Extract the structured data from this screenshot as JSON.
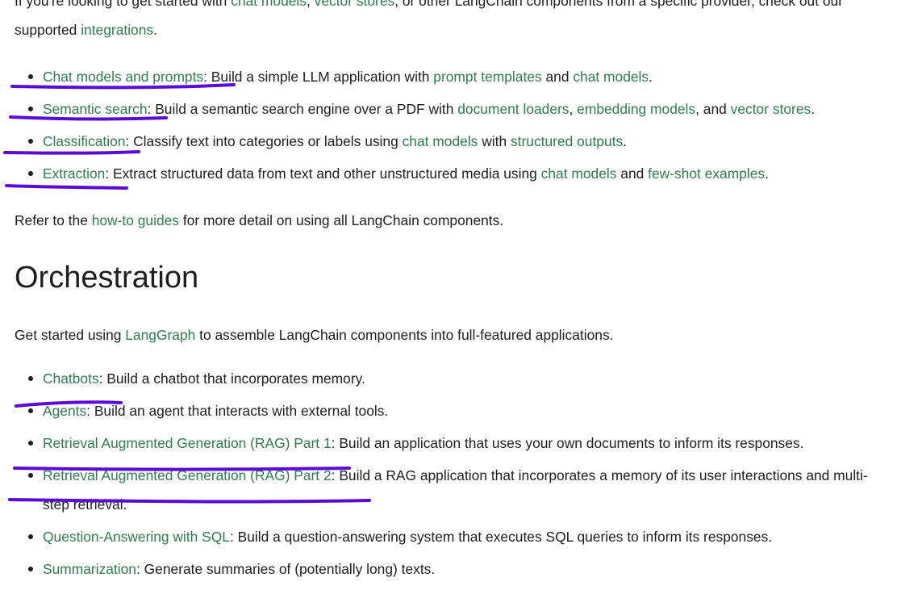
{
  "intro": {
    "t1": "If you're looking to get started with ",
    "l1": "chat models",
    "t2": ", ",
    "l2": "vector stores",
    "t3": ", or other LangChain components from a specific provider, check out our supported ",
    "l3": "integrations",
    "t4": "."
  },
  "basics": {
    "items": [
      {
        "link": "Chat models and prompts",
        "t1": ": Build a simple LLM application with ",
        "l1": "prompt templates",
        "t2": " and ",
        "l2": "chat models",
        "t3": "."
      },
      {
        "link": "Semantic search",
        "t1": ": Build a semantic search engine over a PDF with ",
        "l1": "document loaders",
        "t2": ", ",
        "l2": "embedding models",
        "t3": ", and ",
        "l3": "vector stores",
        "t4": "."
      },
      {
        "link": "Classification",
        "t1": ": Classify text into categories or labels using ",
        "l1": "chat models",
        "t2": " with ",
        "l2": "structured outputs",
        "t3": "."
      },
      {
        "link": "Extraction",
        "t1": ": Extract structured data from text and other unstructured media using ",
        "l1": "chat models",
        "t2": " and ",
        "l2": "few-shot examples",
        "t3": "."
      }
    ]
  },
  "refer": {
    "t1": "Refer to the ",
    "l1": "how-to guides",
    "t2": " for more detail on using all LangChain components."
  },
  "orchestration": {
    "heading": "Orchestration",
    "intro_t1": "Get started using ",
    "intro_l1": "LangGraph",
    "intro_t2": " to assemble LangChain components into full-featured applications.",
    "items": [
      {
        "link": "Chatbots",
        "text": ": Build a chatbot that incorporates memory."
      },
      {
        "link": "Agents",
        "text": ": Build an agent that interacts with external tools."
      },
      {
        "link": "Retrieval Augmented Generation (RAG) Part 1",
        "text": ": Build an application that uses your own documents to inform its responses."
      },
      {
        "link": "Retrieval Augmented Generation (RAG) Part 2",
        "text": ": Build a RAG application that incorporates a memory of its user interactions and multi-step retrieval."
      },
      {
        "link": "Question-Answering with SQL",
        "text": ": Build a question-answering system that executes SQL queries to inform its responses."
      },
      {
        "link": "Summarization",
        "text": ": Generate summaries of (potentially long) texts."
      }
    ]
  },
  "colors": {
    "link": "#2e7d4f",
    "text": "#1c1e21",
    "annotation": "#5b0bd6"
  }
}
